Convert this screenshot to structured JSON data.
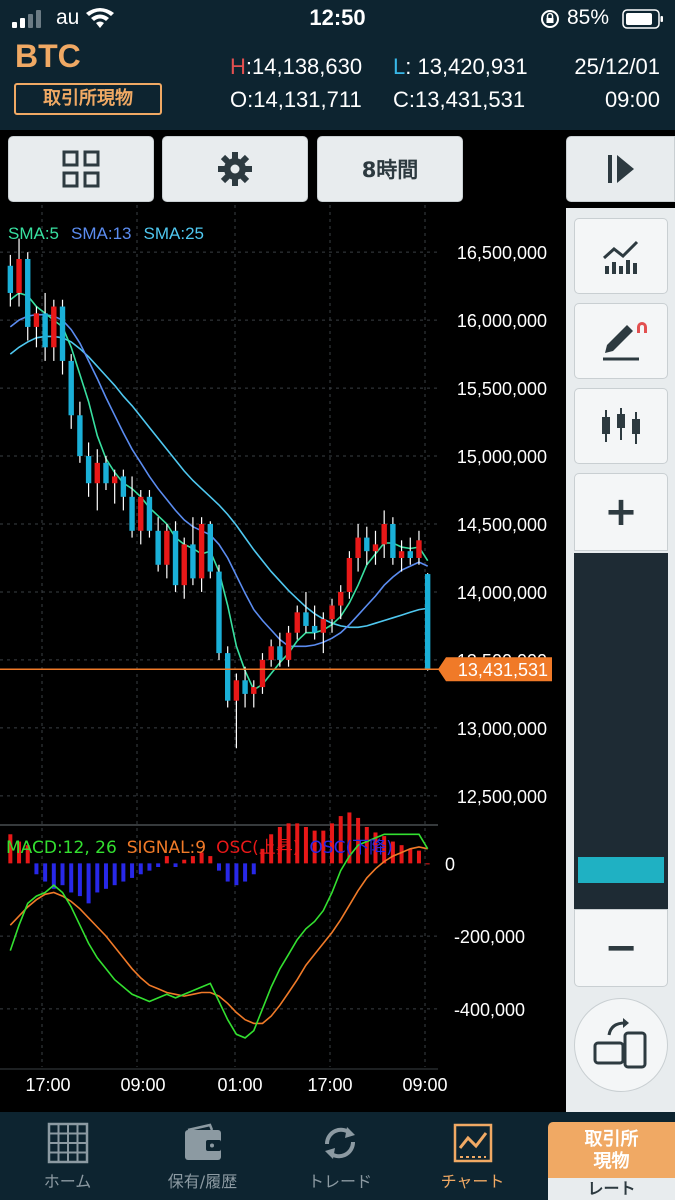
{
  "status_bar": {
    "carrier": "au",
    "time": "12:50",
    "battery": "85%"
  },
  "header": {
    "symbol": "BTC",
    "market": "取引所現物",
    "high_key": "H",
    "high": ":14,138,630",
    "low_key": "L",
    "low": ": 13,420,931",
    "open_key": "O",
    "open": ":14,131,711",
    "close_key": "C",
    "close": ":13,431,531",
    "date": "25/12/01",
    "time": "09:00"
  },
  "toolbar": {
    "grid_icon": "grid-icon",
    "settings_icon": "gear-icon",
    "timeframe": "8時間",
    "play_icon": "play-step-icon"
  },
  "chart": {
    "sma_labels": [
      {
        "text": "SMA:5",
        "color": "#38e0a0"
      },
      {
        "text": "SMA:13",
        "color": "#5b8cf0"
      },
      {
        "text": "SMA:25",
        "color": "#4fc8f0"
      }
    ],
    "price_ticks": [
      "16,500,000",
      "16,000,000",
      "15,500,000",
      "15,000,000",
      "14,500,000",
      "14,000,000",
      "13,500,000",
      "13,000,000",
      "12,500,000"
    ],
    "current_price": "13,431,531",
    "macd_legend": [
      {
        "text": "MACD:12, 26",
        "color": "#33e030"
      },
      {
        "text": "SIGNAL:9",
        "color": "#f07a28"
      },
      {
        "text": "OSC(上昇)",
        "color": "#e81818"
      },
      {
        "text": "OSC(下降)",
        "color": "#2828e8"
      }
    ],
    "macd_ticks": [
      "0",
      "-200,000",
      "-400,000"
    ],
    "time_ticks": [
      "17:00",
      "09:00",
      "01:00",
      "17:00",
      "09:00"
    ],
    "colors": {
      "up": "#e81818",
      "down": "#1ab0d8",
      "sma5": "#38e0a0",
      "sma13": "#5b8cf0",
      "sma25": "#4fc8f0",
      "price_line": "#f07a28",
      "macd": "#33e030",
      "signal": "#f07a28"
    }
  },
  "side_panel": {
    "indicator_icon": "line-chart-icon",
    "drawing_icon": "pen-draw-icon",
    "chart_type_icon": "candlestick-icon",
    "zoom_in": "+",
    "zoom_out": "−",
    "zoom_level": 0.08,
    "rotate_icon": "rotate-device-icon"
  },
  "bottom_nav": [
    {
      "label": "ホーム",
      "icon": "home-grid-icon"
    },
    {
      "label": "保有/履歴",
      "icon": "wallet-icon"
    },
    {
      "label": "トレード",
      "icon": "refresh-arrows-icon"
    },
    {
      "label": "チャート",
      "icon": "chart-icon"
    }
  ],
  "trade_button": {
    "line1": "取引所",
    "line2": "現物",
    "sub": "レート"
  },
  "chart_data": {
    "type": "candlestick",
    "title": "",
    "price_axis": {
      "min": 12300000,
      "max": 16700000,
      "ticks": [
        16500000,
        16000000,
        15500000,
        15000000,
        14500000,
        14000000,
        13500000,
        13000000,
        12500000
      ]
    },
    "x_ticks": [
      "17:00",
      "09:00",
      "01:00",
      "17:00",
      "09:00"
    ],
    "candles": [
      [
        16400000,
        16480000,
        16100000,
        16200000
      ],
      [
        16200000,
        16600000,
        16100000,
        16450000
      ],
      [
        16450000,
        16500000,
        15850000,
        15950000
      ],
      [
        15950000,
        16100000,
        15800000,
        16050000
      ],
      [
        16050000,
        16200000,
        15700000,
        15800000
      ],
      [
        15800000,
        16150000,
        15700000,
        16100000
      ],
      [
        16100000,
        16150000,
        15600000,
        15700000
      ],
      [
        15700000,
        15750000,
        15200000,
        15300000
      ],
      [
        15300000,
        15400000,
        14950000,
        15000000
      ],
      [
        15000000,
        15100000,
        14700000,
        14800000
      ],
      [
        14800000,
        15050000,
        14600000,
        14950000
      ],
      [
        14950000,
        15000000,
        14750000,
        14800000
      ],
      [
        14800000,
        14900000,
        14650000,
        14850000
      ],
      [
        14850000,
        14900000,
        14600000,
        14700000
      ],
      [
        14700000,
        14850000,
        14400000,
        14450000
      ],
      [
        14450000,
        14750000,
        14350000,
        14700000
      ],
      [
        14700000,
        14750000,
        14400000,
        14450000
      ],
      [
        14450000,
        14550000,
        14150000,
        14200000
      ],
      [
        14200000,
        14500000,
        14100000,
        14450000
      ],
      [
        14450000,
        14520000,
        14000000,
        14050000
      ],
      [
        14050000,
        14400000,
        13950000,
        14350000
      ],
      [
        14350000,
        14550000,
        14050000,
        14100000
      ],
      [
        14100000,
        14550000,
        14000000,
        14500000
      ],
      [
        14500000,
        14520000,
        14100000,
        14150000
      ],
      [
        14150000,
        14200000,
        13500000,
        13550000
      ],
      [
        13550000,
        13600000,
        13150000,
        13200000
      ],
      [
        13200000,
        13400000,
        12850000,
        13350000
      ],
      [
        13350000,
        13450000,
        13150000,
        13250000
      ],
      [
        13250000,
        13350000,
        13150000,
        13300000
      ],
      [
        13300000,
        13550000,
        13250000,
        13500000
      ],
      [
        13500000,
        13650000,
        13450000,
        13600000
      ],
      [
        13600000,
        13700000,
        13450000,
        13500000
      ],
      [
        13500000,
        13750000,
        13450000,
        13700000
      ],
      [
        13700000,
        13900000,
        13650000,
        13850000
      ],
      [
        13850000,
        14000000,
        13700000,
        13750000
      ],
      [
        13750000,
        13900000,
        13650000,
        13700000
      ],
      [
        13700000,
        13850000,
        13550000,
        13800000
      ],
      [
        13800000,
        13950000,
        13700000,
        13900000
      ],
      [
        13900000,
        14050000,
        13800000,
        14000000
      ],
      [
        14000000,
        14300000,
        13950000,
        14250000
      ],
      [
        14250000,
        14500000,
        14150000,
        14400000
      ],
      [
        14400000,
        14480000,
        14200000,
        14300000
      ],
      [
        14300000,
        14450000,
        14200000,
        14350000
      ],
      [
        14350000,
        14600000,
        14250000,
        14500000
      ],
      [
        14500000,
        14550000,
        14200000,
        14250000
      ],
      [
        14250000,
        14380000,
        14150000,
        14300000
      ],
      [
        14300000,
        14400000,
        14200000,
        14250000
      ],
      [
        14250000,
        14450000,
        14200000,
        14380000
      ],
      [
        14131711,
        14138630,
        13420931,
        13431531
      ]
    ],
    "sma5": [
      16150000,
      16200000,
      16180000,
      16100000,
      16050000,
      16000000,
      15950000,
      15800000,
      15600000,
      15400000,
      15150000,
      14980000,
      14880000,
      14800000,
      14760000,
      14700000,
      14620000,
      14560000,
      14500000,
      14400000,
      14350000,
      14320000,
      14280000,
      14300000,
      14150000,
      13900000,
      13600000,
      13420000,
      13280000,
      13320000,
      13400000,
      13480000,
      13550000,
      13640000,
      13700000,
      13700000,
      13720000,
      13760000,
      13820000,
      13920000,
      14050000,
      14200000,
      14280000,
      14360000,
      14360000,
      14330000,
      14320000,
      14330000,
      14230000
    ],
    "sma13": [
      15950000,
      16000000,
      16030000,
      16040000,
      16040000,
      16030000,
      16000000,
      15930000,
      15830000,
      15700000,
      15570000,
      15430000,
      15300000,
      15170000,
      15050000,
      14950000,
      14850000,
      14760000,
      14680000,
      14600000,
      14530000,
      14480000,
      14450000,
      14420000,
      14350000,
      14250000,
      14120000,
      13990000,
      13870000,
      13790000,
      13720000,
      13650000,
      13600000,
      13600000,
      13600000,
      13610000,
      13630000,
      13660000,
      13700000,
      13760000,
      13830000,
      13900000,
      13970000,
      14050000,
      14110000,
      14160000,
      14190000,
      14220000,
      14190000
    ],
    "sma25": [
      15750000,
      15800000,
      15840000,
      15870000,
      15880000,
      15880000,
      15870000,
      15840000,
      15790000,
      15730000,
      15660000,
      15590000,
      15520000,
      15440000,
      15370000,
      15290000,
      15210000,
      15130000,
      15050000,
      14970000,
      14890000,
      14820000,
      14760000,
      14700000,
      14640000,
      14570000,
      14490000,
      14400000,
      14310000,
      14230000,
      14150000,
      14080000,
      14010000,
      13950000,
      13890000,
      13840000,
      13800000,
      13770000,
      13750000,
      13740000,
      13740000,
      13750000,
      13770000,
      13790000,
      13810000,
      13830000,
      13850000,
      13870000,
      13880000
    ],
    "macd_axis": {
      "min": -560000,
      "max": 100000,
      "ticks": [
        0,
        -200000,
        -400000
      ]
    },
    "macd": [
      -240000,
      -170000,
      -110000,
      -90000,
      -80000,
      -60000,
      -80000,
      -120000,
      -170000,
      -220000,
      -260000,
      -290000,
      -320000,
      -340000,
      -360000,
      -370000,
      -380000,
      -370000,
      -360000,
      -370000,
      -360000,
      -350000,
      -340000,
      -330000,
      -380000,
      -430000,
      -470000,
      -480000,
      -460000,
      -400000,
      -340000,
      -290000,
      -250000,
      -210000,
      -180000,
      -160000,
      -130000,
      -80000,
      -20000,
      20000,
      50000,
      60000,
      70000,
      80000,
      80000,
      80000,
      80000,
      80000,
      40000
    ],
    "signal": [
      -170000,
      -145000,
      -120000,
      -100000,
      -85000,
      -80000,
      -90000,
      -105000,
      -125000,
      -150000,
      -175000,
      -200000,
      -230000,
      -260000,
      -290000,
      -315000,
      -335000,
      -345000,
      -355000,
      -360000,
      -365000,
      -360000,
      -355000,
      -355000,
      -365000,
      -385000,
      -410000,
      -430000,
      -440000,
      -440000,
      -420000,
      -390000,
      -355000,
      -320000,
      -280000,
      -250000,
      -220000,
      -190000,
      -155000,
      -115000,
      -75000,
      -40000,
      -15000,
      5000,
      20000,
      30000,
      40000,
      45000,
      40000
    ],
    "osc": [
      80000,
      60000,
      50000,
      -30000,
      -50000,
      -70000,
      -60000,
      -80000,
      -90000,
      -110000,
      -80000,
      -70000,
      -60000,
      -50000,
      -40000,
      -30000,
      -20000,
      -10000,
      20000,
      -10000,
      10000,
      20000,
      30000,
      20000,
      -20000,
      -50000,
      -60000,
      -50000,
      -30000,
      40000,
      80000,
      100000,
      110000,
      110000,
      100000,
      90000,
      90000,
      110000,
      130000,
      140000,
      125000,
      100000,
      85000,
      75000,
      60000,
      50000,
      40000,
      35000,
      0
    ]
  }
}
